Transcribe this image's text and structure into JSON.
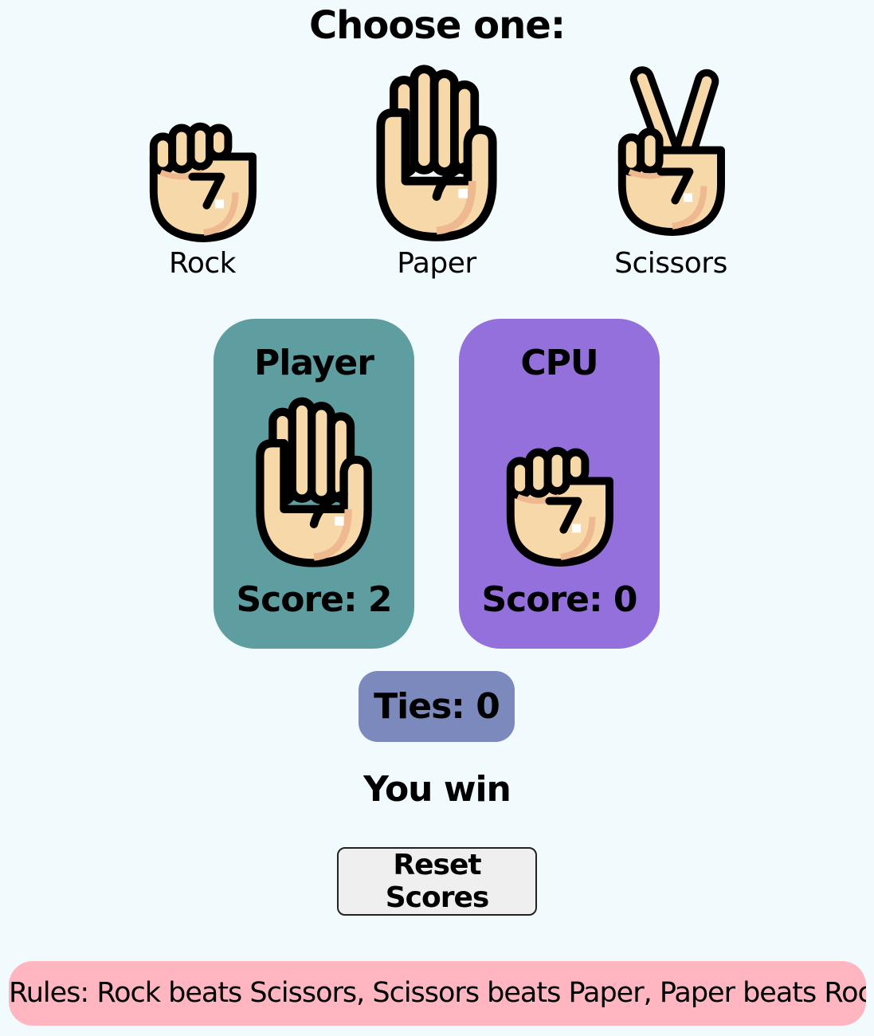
{
  "heading": "Choose one:",
  "choices": [
    {
      "label": "Rock",
      "icon": "rock-fist-icon"
    },
    {
      "label": "Paper",
      "icon": "paper-hand-icon"
    },
    {
      "label": "Scissors",
      "icon": "scissors-hand-icon"
    }
  ],
  "player": {
    "title": "Player",
    "choice_icon": "paper-hand-icon",
    "score": "Score: 2"
  },
  "cpu": {
    "title": "CPU",
    "choice_icon": "rock-fist-icon",
    "score": "Score: 0"
  },
  "ties": "Ties: 0",
  "result": "You win",
  "reset_label": "Reset Scores",
  "rules": "Rules: Rock beats Scissors, Scissors beats Paper, Paper beats Rock.",
  "colors": {
    "background": "#f1fafd",
    "player_card": "#5f9ea0",
    "cpu_card": "#9370db",
    "ties_badge": "#7b89bd",
    "rules_bar": "#ffb6c1",
    "skin": "#f6d8a9",
    "skin_shade": "#efb98f",
    "outline": "#000000"
  }
}
